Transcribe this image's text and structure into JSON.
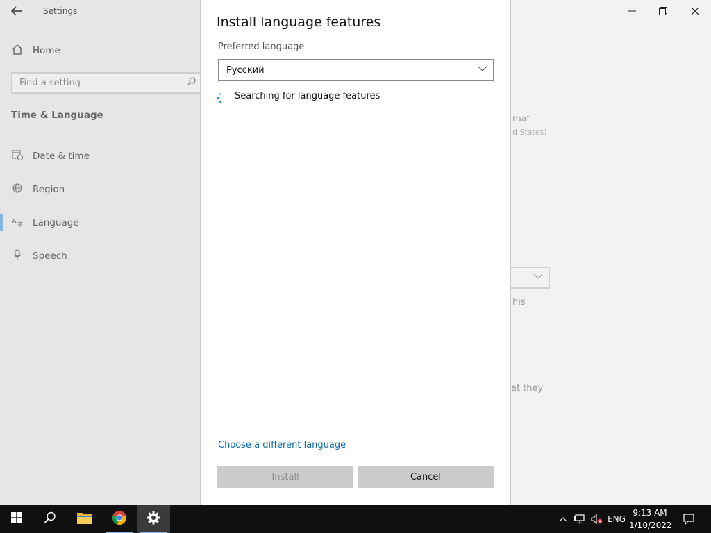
{
  "settings": {
    "app_title": "Settings",
    "home_label": "Home",
    "search_placeholder": "Find a setting",
    "section_title": "Time & Language",
    "nav": [
      {
        "label": "Date & time",
        "icon": "calendar-clock-icon",
        "selected": false
      },
      {
        "label": "Region",
        "icon": "globe-icon",
        "selected": false
      },
      {
        "label": "Language",
        "icon": "language-icon",
        "selected": true
      },
      {
        "label": "Speech",
        "icon": "microphone-icon",
        "selected": false
      }
    ],
    "background_fragments": [
      "mat",
      "d States)",
      "his",
      "at they"
    ]
  },
  "dialog": {
    "title": "Install language features",
    "preferred_label": "Preferred language",
    "selected_language": "Русский",
    "status": "Searching for language features",
    "different_language_link": "Choose a different language",
    "install_label": "Install",
    "cancel_label": "Cancel"
  },
  "taskbar": {
    "apps": [
      "start-icon",
      "search-icon",
      "file-explorer-icon",
      "chrome-icon",
      "settings-gear-icon"
    ],
    "tray_language": "ENG",
    "time": "9:13 AM",
    "date": "1/10/2022"
  },
  "colors": {
    "accent": "#0a68b0",
    "spinner": "#1f7ec0",
    "selection_bar": "#86b7e0"
  }
}
